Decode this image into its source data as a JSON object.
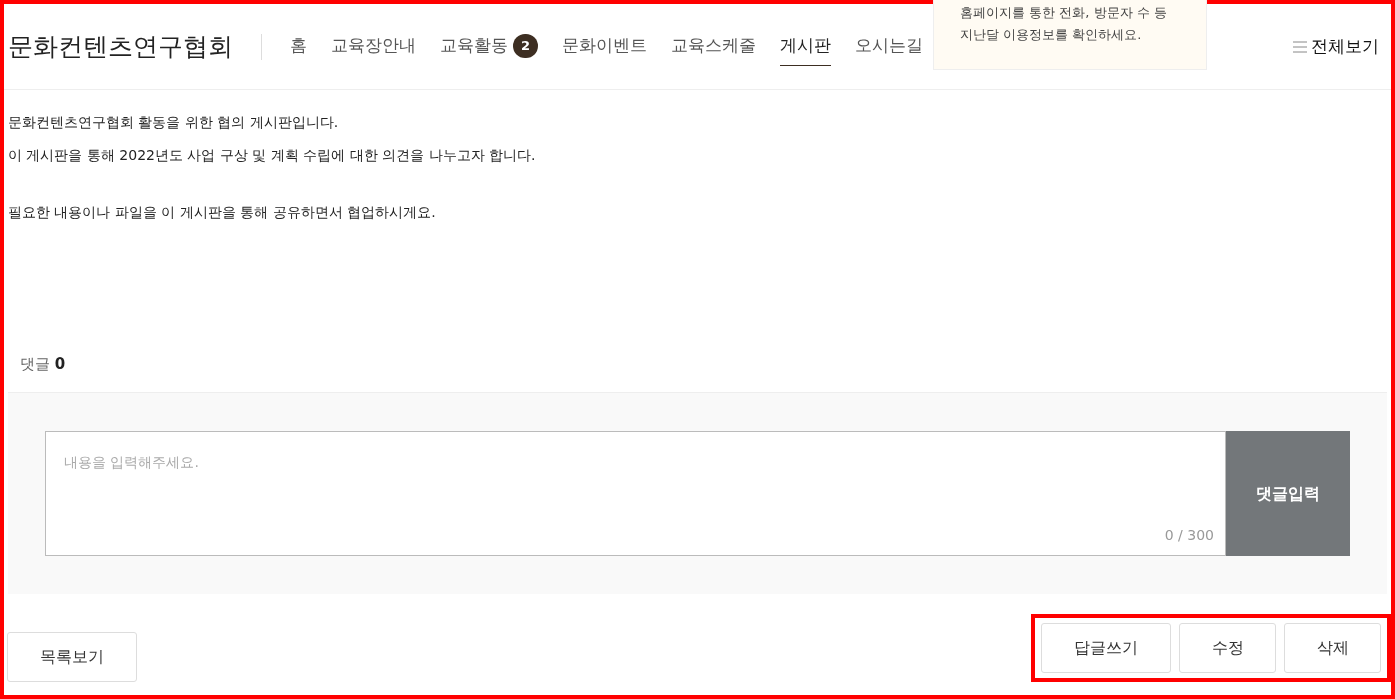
{
  "header": {
    "site_title": "문화컨텐츠연구협회",
    "nav": [
      {
        "label": "홈",
        "selected": false
      },
      {
        "label": "교육장안내",
        "selected": false
      },
      {
        "label": "교육활동",
        "selected": false,
        "badge": "2"
      },
      {
        "label": "문화이벤트",
        "selected": false
      },
      {
        "label": "교육스케줄",
        "selected": false
      },
      {
        "label": "게시판",
        "selected": true
      },
      {
        "label": "오시는길",
        "selected": false
      }
    ],
    "tooltip": [
      "홈페이지를 통한 전화, 방문자 수 등",
      "지난달 이용정보를 확인하세요."
    ],
    "menu_button": "전체보기"
  },
  "post": {
    "blocks": [
      [
        "문화컨텐츠연구협회 활동을 위한 협의 게시판입니다.",
        "이 게시판을 통해 2022년도 사업 구상 및 계획 수립에 대한 의견을 나누고자 합니다."
      ],
      [
        "필요한 내용이나 파일을 이 게시판을 통해 공유하면서 협업하시게요."
      ]
    ]
  },
  "comments": {
    "label": "댓글",
    "count": "0",
    "placeholder": "내용을 입력해주세요.",
    "counter": "0 / 300",
    "submit": "댓글입력"
  },
  "footer": {
    "left_buttons": [
      "목록보기"
    ],
    "right_buttons": [
      "답글쓰기",
      "수정",
      "삭제"
    ]
  }
}
